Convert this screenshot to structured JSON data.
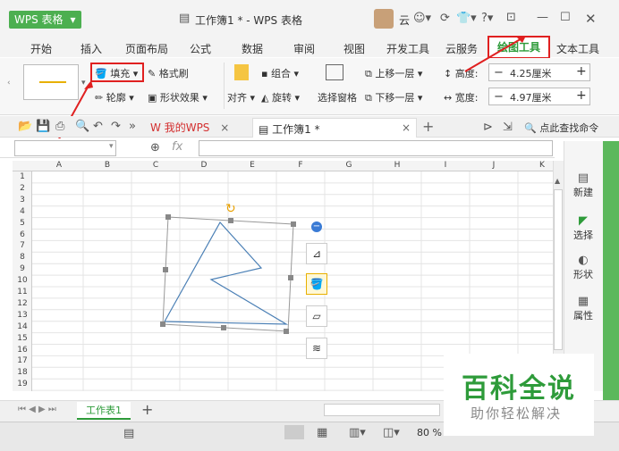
{
  "app": {
    "logo": "WPS 表格",
    "title": "工作簿1 * - WPS 表格",
    "user_initial": "云"
  },
  "ribbon_tabs": [
    "开始",
    "插入",
    "页面布局",
    "公式",
    "数据",
    "审阅",
    "视图",
    "开发工具",
    "云服务",
    "绘图工具",
    "文本工具"
  ],
  "ribbon": {
    "fill": "填充",
    "format_brush": "格式刷",
    "outline": "轮廓",
    "shape_effect": "形状效果",
    "combine": "组合",
    "align": "对齐",
    "rotate": "旋转",
    "select_pane": "选择窗格",
    "bring_forward": "上移一层",
    "send_backward": "下移一层",
    "height_label": "高度:",
    "height_value": "4.25厘米",
    "width_label": "宽度:",
    "width_value": "4.97厘米",
    "minus": "−",
    "plus": "+"
  },
  "doc_tabs": {
    "my_wps": "我的WPS",
    "workbook": "工作簿1 *",
    "search_cmd": "点此查找命令"
  },
  "formula": {
    "fx": "fx"
  },
  "columns": [
    "A",
    "B",
    "C",
    "D",
    "E",
    "F",
    "G",
    "H",
    "I",
    "J",
    "K"
  ],
  "rows": [
    "1",
    "2",
    "3",
    "4",
    "5",
    "6",
    "7",
    "8",
    "9",
    "10",
    "11",
    "12",
    "13",
    "14",
    "15",
    "16",
    "17",
    "18",
    "19"
  ],
  "right_panel": [
    "新建",
    "选择",
    "形状",
    "属性"
  ],
  "sheet": {
    "name": "工作表1",
    "add": "+"
  },
  "status": {
    "zoom": "80 %"
  },
  "watermark": {
    "line1": "百科全说",
    "line2": "助你轻松解决"
  },
  "colors": {
    "brand_green": "#4caf50",
    "accent_green": "#2e9b3a",
    "highlight_red": "#e02020",
    "shape_stroke": "#4a7fb5"
  }
}
